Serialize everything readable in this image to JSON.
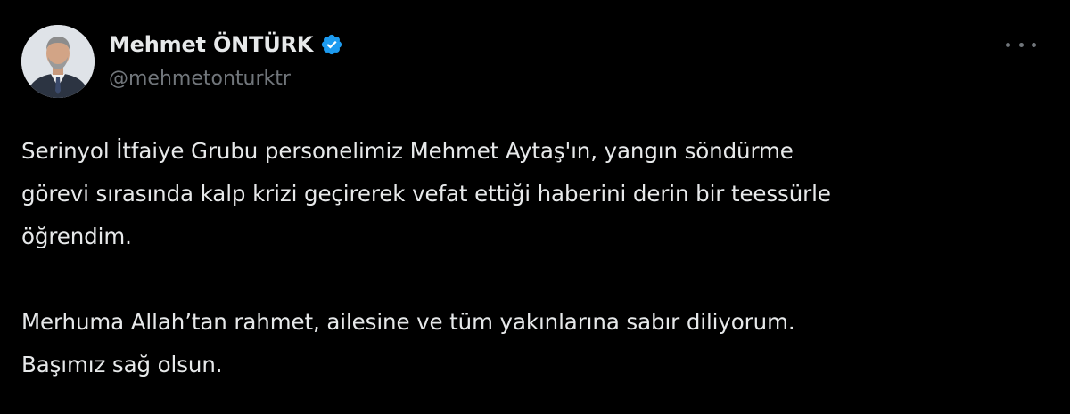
{
  "author": {
    "display_name": "Mehmet ÖNTÜRK",
    "handle": "@mehmetonturktr",
    "verified": true,
    "avatar_icon": "profile-photo"
  },
  "menu": {
    "icon": "more-options-icon"
  },
  "tweet": {
    "lines": [
      "Serinyol İtfaiye Grubu personelimiz Mehmet Aytaş'ın, yangın söndürme",
      "görevi sırasında kalp krizi geçirerek vefat ettiği haberini derin bir teessürle",
      "öğrendim.",
      "Merhuma Allah’tan rahmet, ailesine ve tüm yakınlarına sabır diliyorum.",
      "Başımız sağ olsun."
    ]
  },
  "colors": {
    "background": "#000000",
    "text": "#e7e9ea",
    "secondary": "#71767b",
    "verified": "#1d9bf0"
  }
}
